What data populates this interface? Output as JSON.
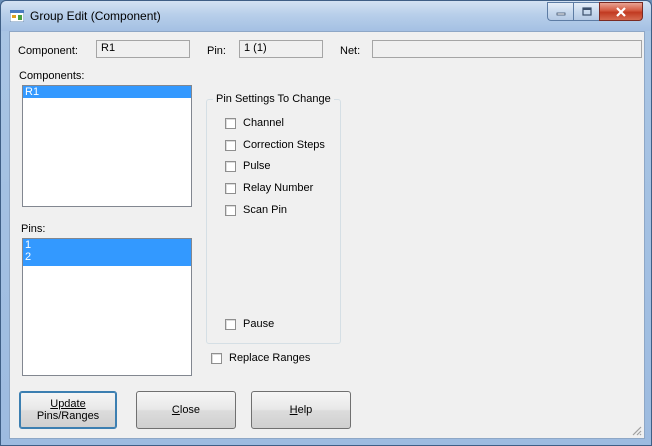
{
  "window": {
    "title": "Group Edit (Component)"
  },
  "header": {
    "component_label": "Component:",
    "component_value": "R1",
    "pin_label": "Pin:",
    "pin_value": "1 (1)",
    "net_label": "Net:",
    "net_value": ""
  },
  "components": {
    "label": "Components:",
    "items": [
      "R1"
    ],
    "selected_index": 0
  },
  "pins": {
    "label": "Pins:",
    "items": [
      "1",
      "2"
    ],
    "selected": [
      "1",
      "2"
    ]
  },
  "pin_settings": {
    "group_title": "Pin Settings To Change",
    "options": [
      {
        "label": "Channel",
        "checked": false
      },
      {
        "label": "Correction Steps",
        "checked": false
      },
      {
        "label": "Pulse",
        "checked": false
      },
      {
        "label": "Relay Number",
        "checked": false
      },
      {
        "label": "Scan Pin",
        "checked": false
      }
    ],
    "pause": {
      "label": "Pause",
      "checked": false
    }
  },
  "replace_ranges": {
    "label": "Replace Ranges",
    "checked": false
  },
  "buttons": {
    "update_line1": "Update",
    "update_line2": "Pins/Ranges",
    "close_first": "C",
    "close_rest": "lose",
    "help_first": "H",
    "help_rest": "elp"
  },
  "colors": {
    "selection": "#3399ff",
    "client_bg": "#f0f0f0",
    "close_button": "#c13a21"
  }
}
